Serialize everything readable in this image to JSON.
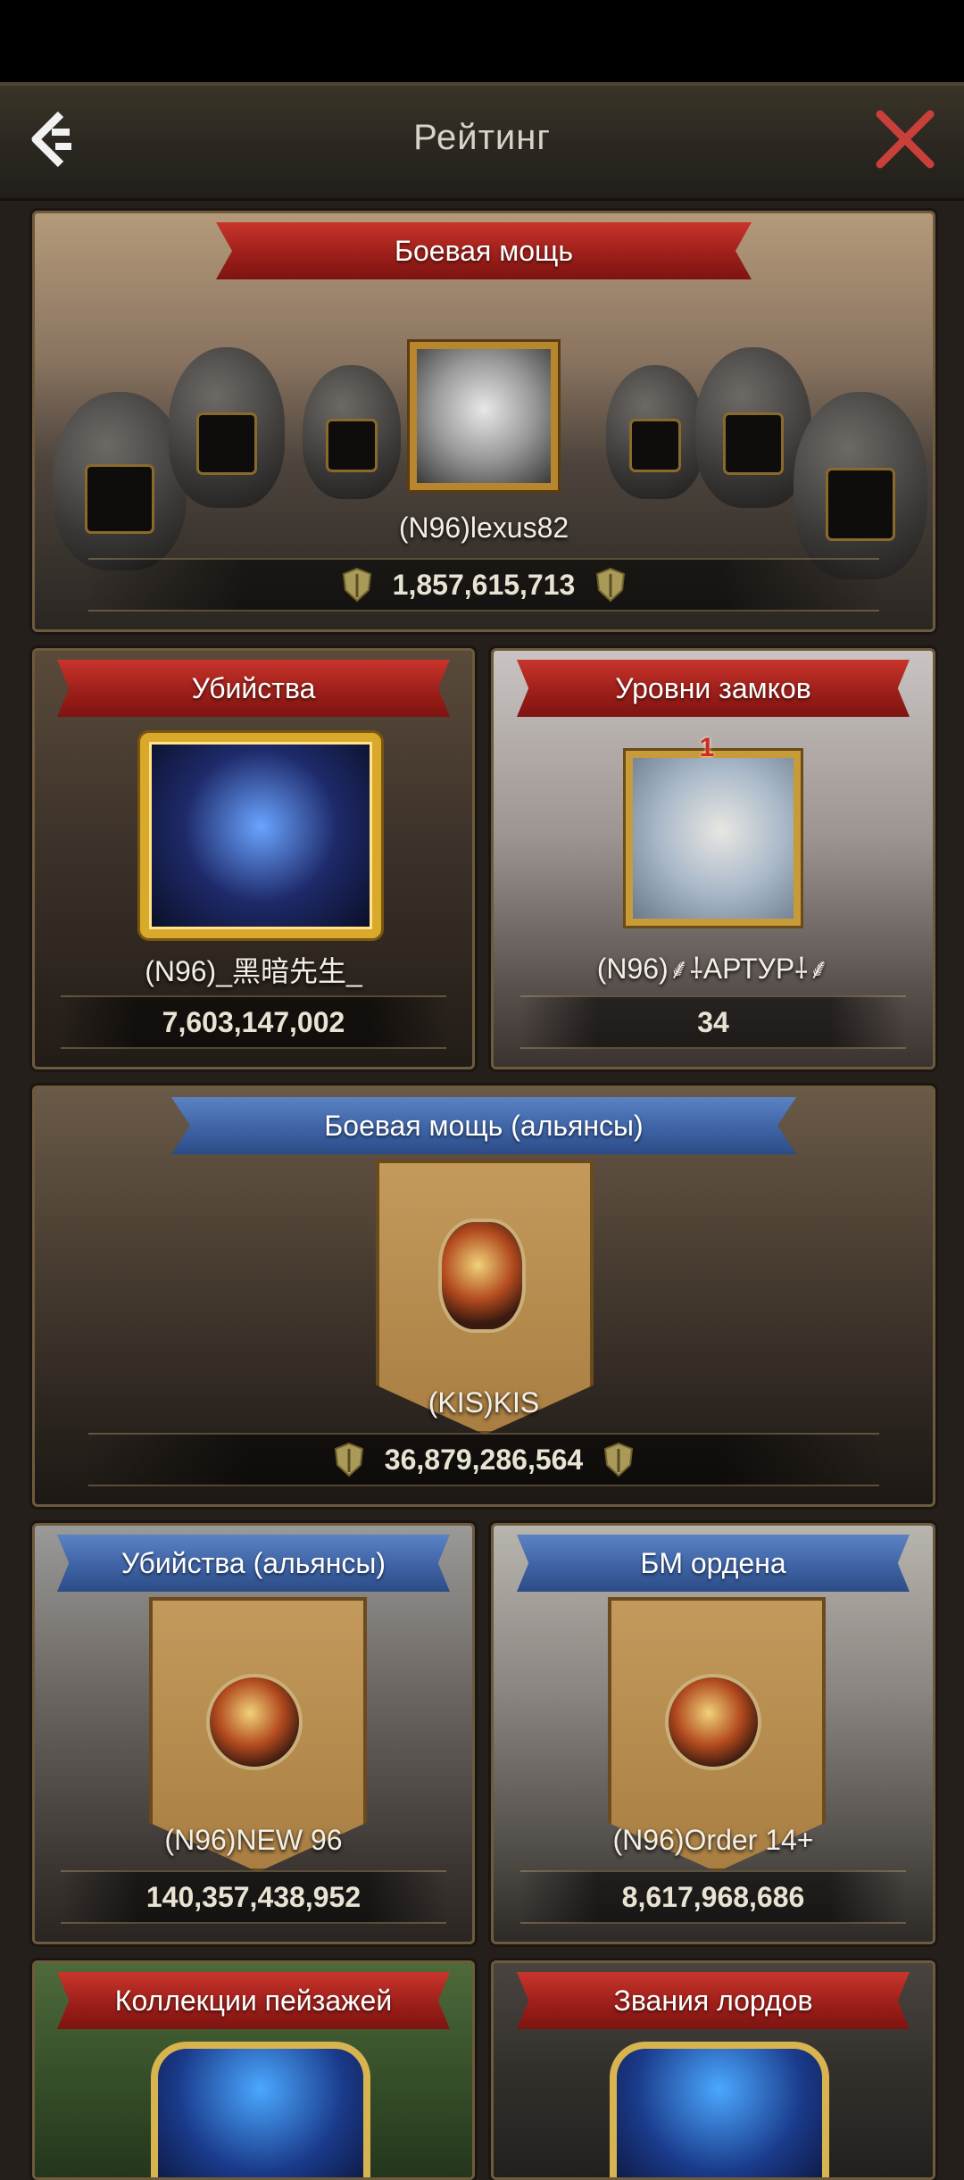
{
  "header": {
    "title": "Рейтинг"
  },
  "cards": {
    "power": {
      "title": "Боевая мощь",
      "name": "(N96)lexus82",
      "value": "1,857,615,713"
    },
    "kills": {
      "title": "Убийства",
      "name": "(N96)_黑暗先生_",
      "value": "7,603,147,002"
    },
    "castles": {
      "title": "Уровни замков",
      "name": "(N96)⸙⸸АРТУР⸸⸙",
      "value": "34",
      "rank_badge": "1"
    },
    "alliance_power": {
      "title": "Боевая мощь (альянсы)",
      "name": "(KIS)KIS",
      "value": "36,879,286,564"
    },
    "alliance_kills": {
      "title": "Убийства (альянсы)",
      "name": "(N96)NEW 96",
      "value": "140,357,438,952"
    },
    "order_power": {
      "title": "БМ ордена",
      "name": "(N96)Order 14+",
      "value": "8,617,968,686"
    },
    "landscapes": {
      "title": "Коллекции пейзажей"
    },
    "lord_titles": {
      "title": "Звания лордов"
    }
  },
  "colors": {
    "red_ribbon": "#b3271f",
    "blue_ribbon": "#4669aa",
    "frame": "#6e5a3c"
  },
  "icons": [
    "back-icon",
    "close-icon",
    "power-shield-icon"
  ]
}
